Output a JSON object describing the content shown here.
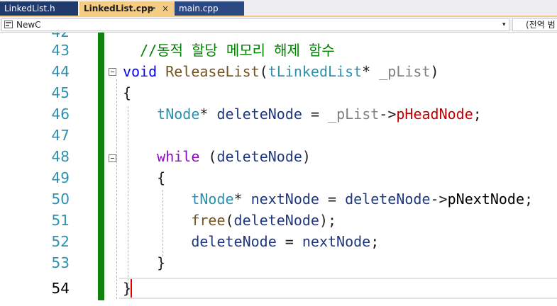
{
  "tabs": [
    {
      "label": "LinkedList.h",
      "active": false
    },
    {
      "label": "LinkedList.cpp",
      "active": true,
      "pin_glyph": "⊸",
      "close_glyph": "×"
    },
    {
      "label": "main.cpp",
      "active": false
    }
  ],
  "navbar": {
    "scope_value": "NewC",
    "scope_icon": "class-icon",
    "dropdown_glyph": "▾",
    "right_value": "(전역 범"
  },
  "editor": {
    "partial_top_line_number": "42",
    "line_numbers": [
      "43",
      "44",
      "45",
      "46",
      "47",
      "48",
      "49",
      "50",
      "51",
      "52",
      "53",
      "54"
    ],
    "current_line": "54",
    "lines": {
      "l43": {
        "comment": "//동적 할당 메모리 해제 함수"
      },
      "l44": {
        "kw_void": "void",
        "fn": "ReleaseList",
        "open": "(",
        "type": "tLinkedList",
        "star": "*",
        "param": "_pList",
        "close": ")"
      },
      "l45": {
        "brace": "{"
      },
      "l46": {
        "type": "tNode",
        "star": "*",
        "var": "deleteNode",
        "eq": " = ",
        "param": "_pList",
        "arrow": "->",
        "member": "pHeadNode",
        "semi": ";"
      },
      "l48": {
        "kw": "while",
        "open": " (",
        "var": "deleteNode",
        "close": ")"
      },
      "l49": {
        "brace": "{"
      },
      "l50": {
        "type": "tNode",
        "star": "*",
        "var": "nextNode",
        "eq": " = ",
        "var2": "deleteNode",
        "arrow": "->",
        "member": "pNextNode",
        "semi": ";"
      },
      "l51": {
        "fn": "free",
        "open": "(",
        "var": "deleteNode",
        "close": ");"
      },
      "l52": {
        "var": "deleteNode",
        "eq": " = ",
        "var2": "nextNode",
        "semi": ";"
      },
      "l53": {
        "brace": "}"
      },
      "l54": {
        "brace": "}"
      }
    },
    "colors": {
      "change_bar": "#108010",
      "line_number": "#2b91af",
      "comment": "#008000",
      "keyword": "#0000ff",
      "control_keyword": "#8f08c4",
      "type": "#2b91af",
      "caret": "#e00000"
    }
  }
}
